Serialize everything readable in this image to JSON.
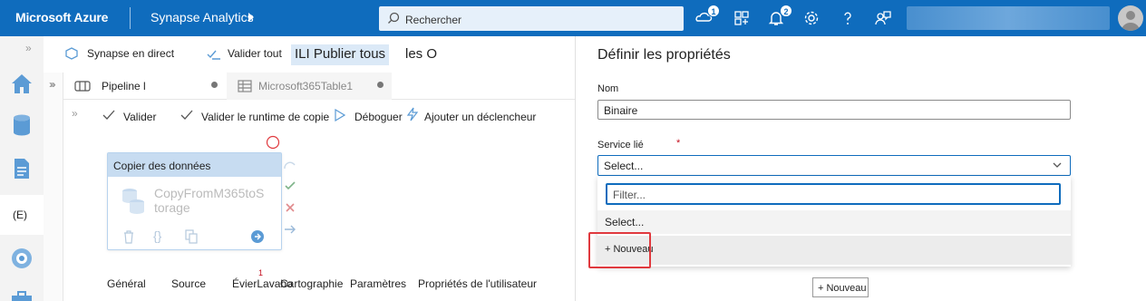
{
  "topbar": {
    "brand": "Microsoft Azure",
    "product": "Synapse Analytics",
    "search_placeholder": "Rechercher",
    "notifications_count": "1",
    "alerts_count": "2",
    "icons": [
      "cloud-shell-icon",
      "directory-icon",
      "bell-icon",
      "gear-icon",
      "help-icon",
      "feedback-icon"
    ]
  },
  "toolbar": {
    "synapse_live": "Synapse en direct",
    "validate_all": "Valider tout",
    "publish_all": "ILI  Publier tous",
    "publish_tail": "les O"
  },
  "tabs": [
    {
      "label": "Pipeline l"
    },
    {
      "label": "Microsoft365Table1"
    }
  ],
  "pipeline_toolbar": {
    "validate": "Valider",
    "validate_runtime": "Valider le runtime de copie",
    "debug": "Déboguer",
    "add_trigger": "Ajouter un déclencheur"
  },
  "activity": {
    "header": "Copier des données",
    "name_line1": "CopyFromM365toS",
    "name_line2": "torage"
  },
  "bottom_tabs": {
    "general": "Général",
    "source": "Source",
    "sink": "ÉvierLavabo",
    "sink_badge": "1",
    "mapping": "Cartographie",
    "parameters": "Paramètres",
    "user_props": "Propriétés de l'utilisateur"
  },
  "rail": {
    "selected_label": "(E)"
  },
  "panel": {
    "title": "Définir les propriétés",
    "name_label": "Nom",
    "name_value": "Binaire",
    "linked_service_label": "Service lié",
    "required_mark": "*",
    "select_value": "Select...",
    "filter_placeholder": "Filter...",
    "option_select": "Select...",
    "option_new": "+ Nouveau",
    "new_button": "+ Nouveau"
  },
  "colors": {
    "brand_blue": "#0f6cbd",
    "activity_header": "#c7dcf1",
    "highlight_red": "#e0393e"
  }
}
